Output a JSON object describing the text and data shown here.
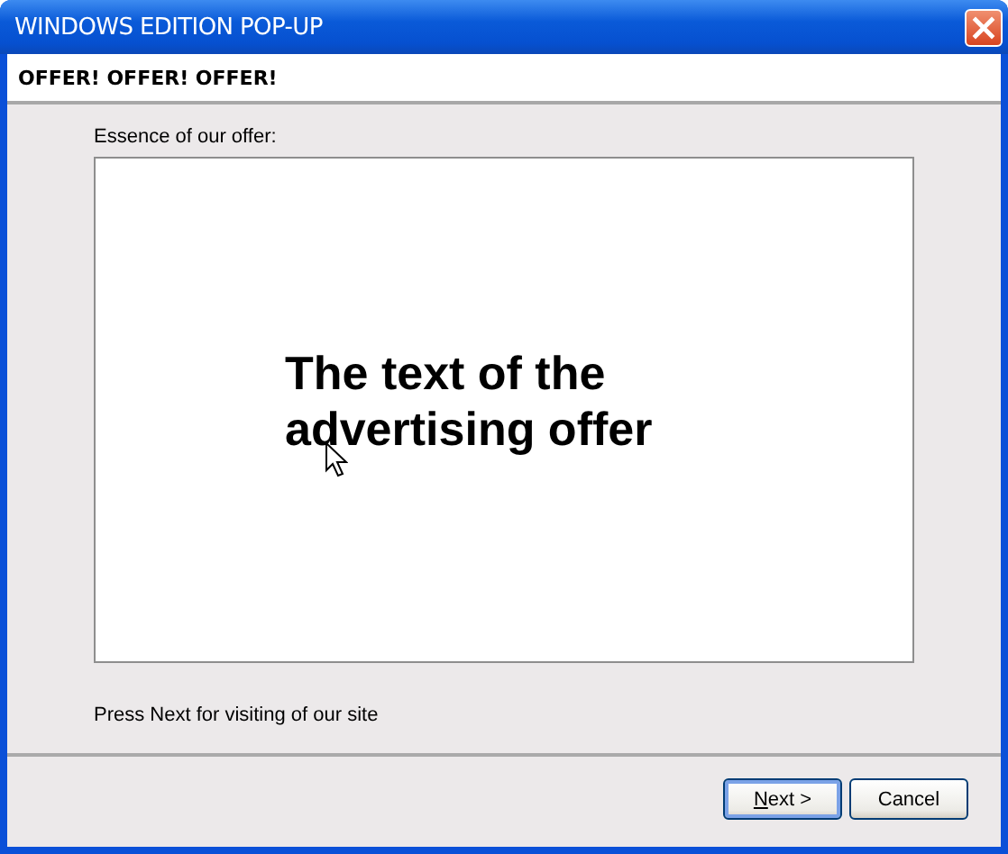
{
  "window": {
    "title": "WINDOWS EDITION POP-UP"
  },
  "header": {
    "title": "OFFER! OFFER! OFFER!"
  },
  "offer": {
    "label": "Essence of our offer:",
    "text": "The text of the advertising offer"
  },
  "hint": "Press Next for visiting of our site",
  "buttons": [
    {
      "label": "Next >",
      "default": true,
      "underline_first": true
    },
    {
      "label": "Cancel",
      "default": false,
      "underline_first": false
    }
  ]
}
